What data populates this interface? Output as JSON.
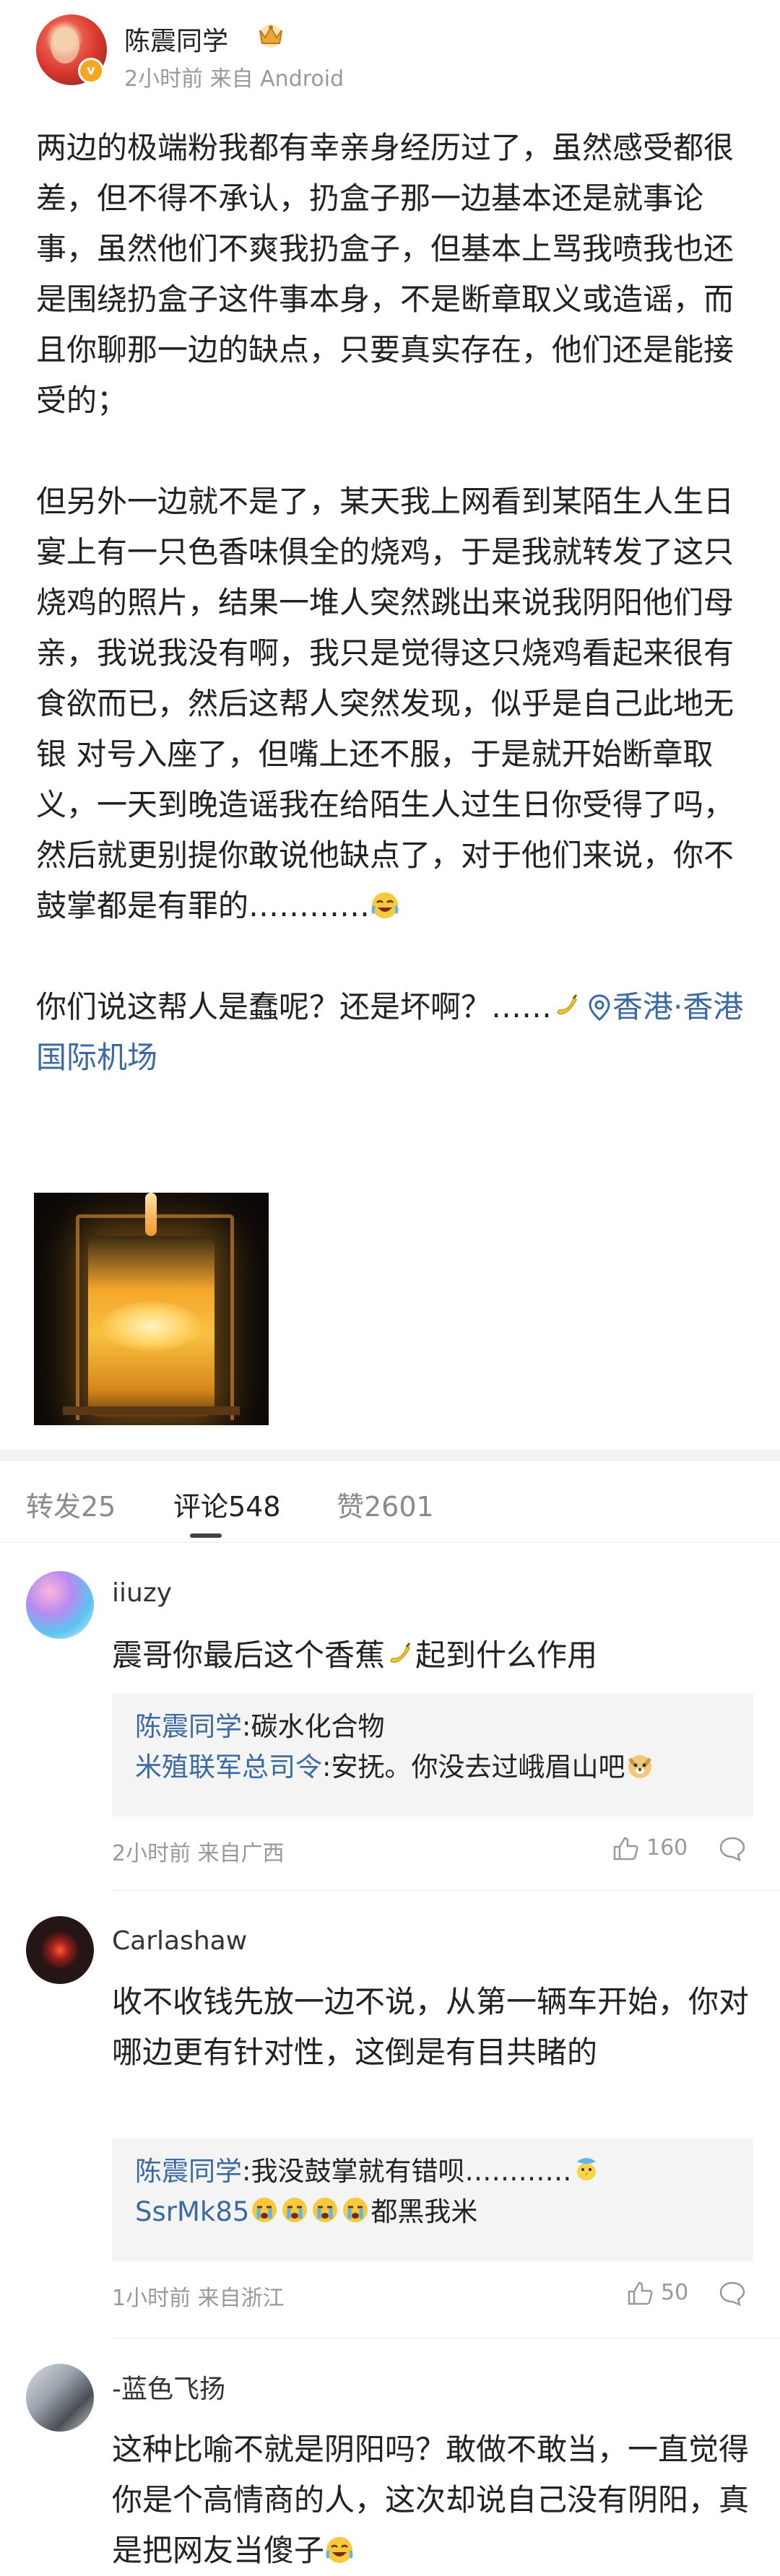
{
  "post": {
    "author": "陈震同学",
    "meta": "2小时前 来自 Android",
    "paragraphs": [
      "两边的极端粉我都有幸亲身经历过了，虽然感受都很差，但不得不承认，扔盒子那一边基本还是就事论事，虽然他们不爽我扔盒子，但基本上骂我喷我也还是围绕扔盒子这件事本身，不是断章取义或造谣，而且你聊那一边的缺点，只要真实存在，他们还是能接受的；",
      "但另外一边就不是了，某天我上网看到某陌生人生日宴上有一只色香味俱全的烧鸡，于是我就转发了这只烧鸡的照片，结果一堆人突然跳出来说我阴阳他们母亲，我说我没有啊，我只是觉得这只烧鸡看起来很有食欲而已，然后这帮人突然发现，似乎是自己此地无银 对号入座了，但嘴上还不服，于是就开始断章取义，一天到晚造谣我在给陌生人过生日你受得了吗，然后就更别提你敢说他缺点了，对于他们来说，你不鼓掌都是有罪的…………"
    ],
    "last_line": "你们说这帮人是蠢呢？还是坏啊？……",
    "location": "香港·香港国际机场"
  },
  "tabs": {
    "repost": "转发25",
    "comments": "评论548",
    "likes": "赞2601"
  },
  "comments": [
    {
      "name": "iiuzy",
      "text": "震哥你最后这个香蕉",
      "text_after_emoji": "起到什么作用",
      "replies": [
        {
          "user": "陈震同学",
          "text": ":碳水化合物"
        },
        {
          "user": "米殖联军总司令",
          "text": ":安抚。你没去过峨眉山吧"
        }
      ],
      "meta": "2小时前 来自广西",
      "likes": "160"
    },
    {
      "name": "Carlashaw",
      "text": "收不收钱先放一边不说，从第一辆车开始，你对哪边更有针对性，这倒是有目共睹的",
      "replies": [
        {
          "user": "陈震同学",
          "text": ":我没鼓掌就有错呗…………"
        },
        {
          "user": "SsrMk85",
          "text": "都黑我米"
        }
      ],
      "meta": "1小时前 来自浙江",
      "likes": "50"
    },
    {
      "name": "-蓝色飞扬",
      "text": "这种比喻不就是阴阳吗？敢做不敢当，一直觉得你是个高情商的人，这次却说自己没有阴阳，真是把网友当傻子"
    }
  ],
  "colors": {
    "link": "#3b6aa3",
    "meta": "#999999",
    "reply_bg": "#f4f4f4"
  }
}
